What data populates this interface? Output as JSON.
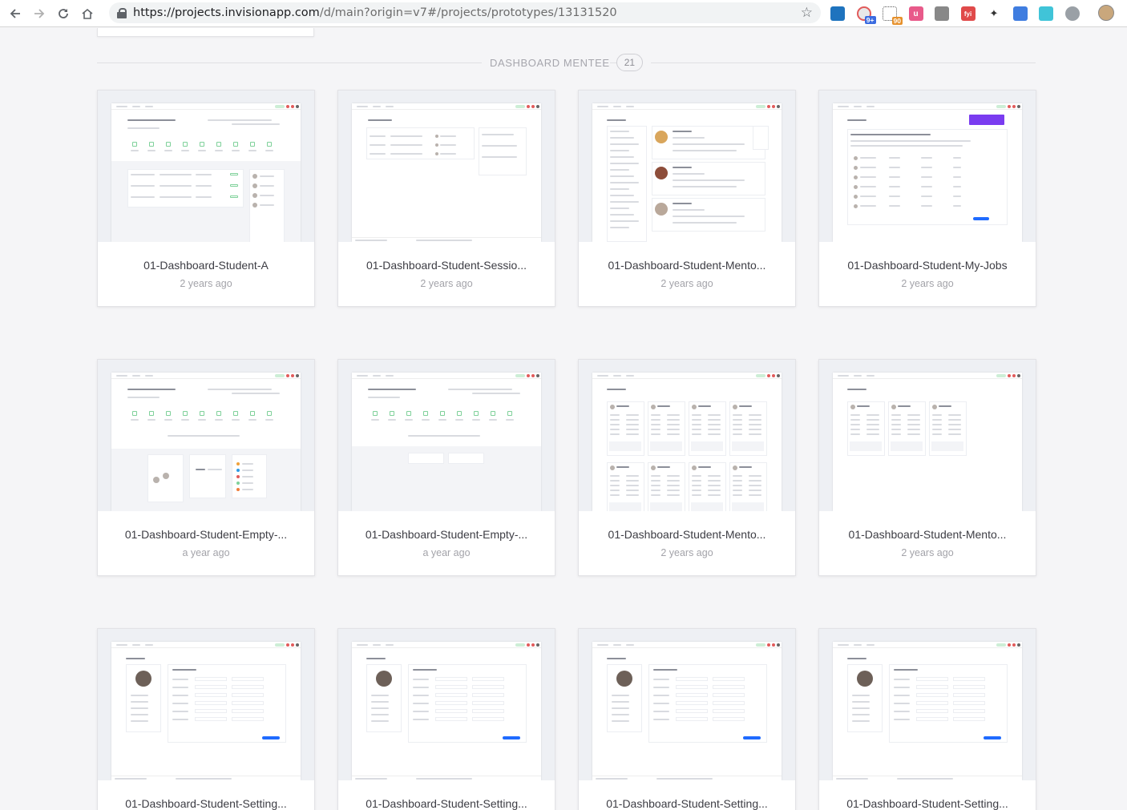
{
  "browser": {
    "url_host": "https://projects.invisionapp.com",
    "url_path": "/d/main?origin=v7#/projects/prototypes/13131520",
    "extension_badges": [
      "9+",
      "90"
    ]
  },
  "section": {
    "title": "DASHBOARD MENTEE",
    "count": "21"
  },
  "cards": [
    {
      "title": "01-Dashboard-Student-A",
      "meta": "2 years ago"
    },
    {
      "title": "01-Dashboard-Student-Sessio...",
      "meta": "2 years ago"
    },
    {
      "title": "01-Dashboard-Student-Mento...",
      "meta": "2 years ago"
    },
    {
      "title": "01-Dashboard-Student-My-Jobs",
      "meta": "2 years ago"
    },
    {
      "title": "01-Dashboard-Student-Empty-...",
      "meta": "a year ago"
    },
    {
      "title": "01-Dashboard-Student-Empty-...",
      "meta": "a year ago"
    },
    {
      "title": "01-Dashboard-Student-Mento...",
      "meta": "2 years ago"
    },
    {
      "title": "01-Dashboard-Student-Mento...",
      "meta": "2 years ago"
    },
    {
      "title": "01-Dashboard-Student-Setting...",
      "meta": ""
    },
    {
      "title": "01-Dashboard-Student-Setting...",
      "meta": ""
    },
    {
      "title": "01-Dashboard-Student-Setting...",
      "meta": ""
    },
    {
      "title": "01-Dashboard-Student-Setting...",
      "meta": ""
    }
  ],
  "colors": {
    "accent_blue": "#1f6bff",
    "accent_green": "#7fd19a",
    "accent_purple": "#7a3cf0",
    "page_bg": "#f5f5f7"
  }
}
